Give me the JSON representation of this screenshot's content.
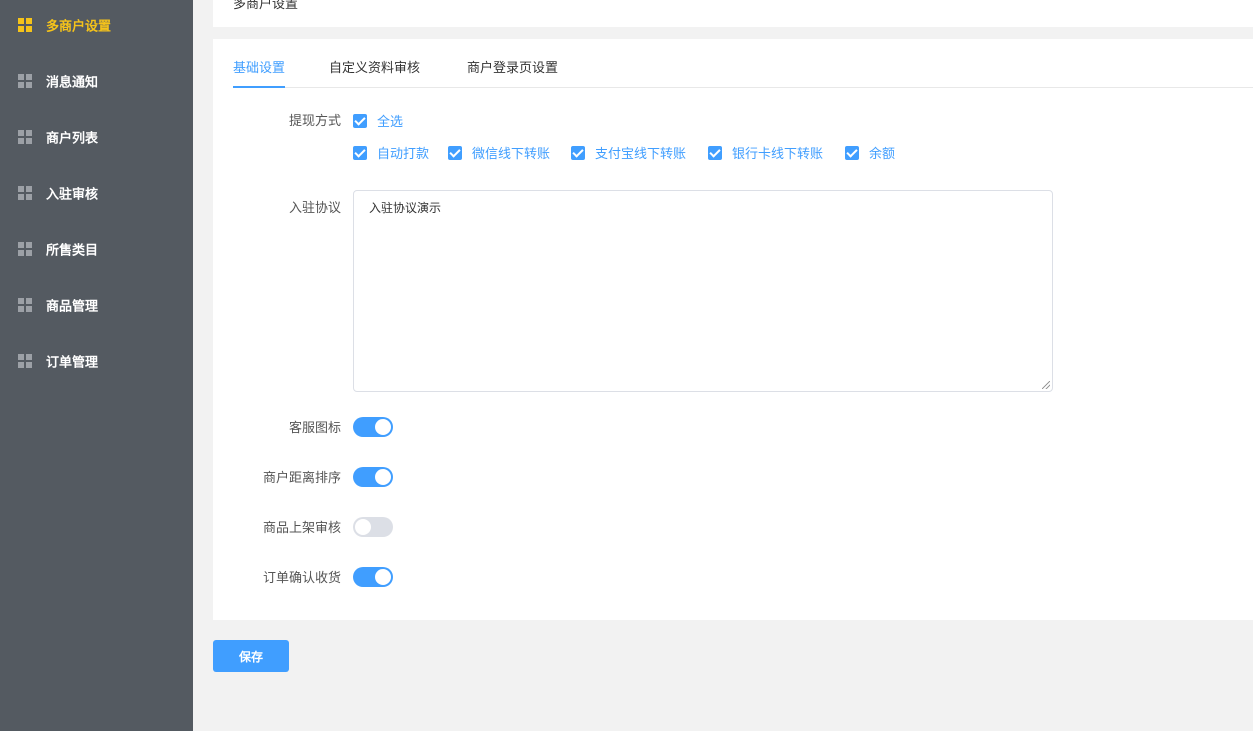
{
  "sidebar": {
    "items": [
      {
        "label": "多商户设置",
        "icon": "grid-icon",
        "active": true
      },
      {
        "label": "消息通知",
        "icon": "grid-icon",
        "active": false
      },
      {
        "label": "商户列表",
        "icon": "grid-icon",
        "active": false
      },
      {
        "label": "入驻审核",
        "icon": "grid-icon",
        "active": false
      },
      {
        "label": "所售类目",
        "icon": "grid-icon",
        "active": false
      },
      {
        "label": "商品管理",
        "icon": "grid-icon",
        "active": false
      },
      {
        "label": "订单管理",
        "icon": "grid-icon",
        "active": false
      }
    ]
  },
  "header": {
    "breadcrumb": "多商户设置"
  },
  "tabs": [
    {
      "label": "基础设置",
      "active": true
    },
    {
      "label": "自定义资料审核",
      "active": false
    },
    {
      "label": "商户登录页设置",
      "active": false
    }
  ],
  "form": {
    "withdraw": {
      "label": "提现方式",
      "select_all": {
        "label": "全选",
        "checked": true
      },
      "options": [
        {
          "label": "自动打款",
          "checked": true
        },
        {
          "label": "微信线下转账",
          "checked": true
        },
        {
          "label": "支付宝线下转账",
          "checked": true
        },
        {
          "label": "银行卡线下转账",
          "checked": true
        },
        {
          "label": "余额",
          "checked": true
        }
      ]
    },
    "agreement": {
      "label": "入驻协议",
      "value": "入驻协议演示"
    },
    "switches": [
      {
        "label": "客服图标",
        "on": true
      },
      {
        "label": "商户距离排序",
        "on": true
      },
      {
        "label": "商品上架审核",
        "on": false
      },
      {
        "label": "订单确认收货",
        "on": true
      }
    ]
  },
  "actions": {
    "save_label": "保存"
  },
  "colors": {
    "accent": "#409eff",
    "sidebar_bg": "#545a61",
    "sidebar_active": "#f5c31a",
    "switch_off": "#dcdfe6"
  }
}
